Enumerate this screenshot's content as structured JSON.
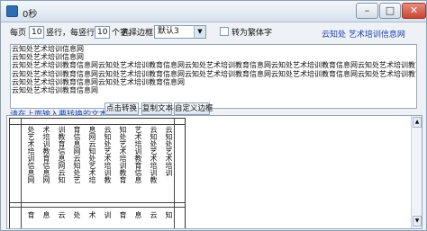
{
  "window": {
    "title": "0秒"
  },
  "options": {
    "per_page_label": "每页",
    "columns_value": "10",
    "columns_unit": "竖行，每竖行",
    "chars_value": "10",
    "chars_unit": "个字，",
    "border_label": "选择边框：",
    "border_selected": "默认3",
    "traditional_label": "转为繁体字"
  },
  "brand_link": "云知处 艺术培训信息网",
  "input_lines": [
    "云知处艺术培训信息网",
    "云知处艺术培训信息网",
    "云知处艺术培训教育信息网云知处艺术培训教育信息网云知处艺术培训教育信息网云知处艺术培训教育信息网云知处艺术培训教育信息网",
    "云知处艺术培训教育信息网云知处艺术培训教育信息网云知处艺术培训教育信息网云知处艺术培训教育信息网云知处艺术培训教育信息网",
    "云知处艺术培训教育信息网云知处艺术培训教育信息网",
    "云知处艺术培训教育信息网"
  ],
  "prompt": "请在上面输入要转换的文本！！",
  "buttons": {
    "convert": "点击转换",
    "copy": "复制文本",
    "border": "自定义边框"
  },
  "output_columns": [
    "处艺术培训信息网",
    "术培训教育信息网",
    "训教育信息网云知",
    "育信息网云知处艺",
    "息网云知处艺术培",
    "云知处艺术培训教",
    "知处艺术培训教育",
    "艺术培训教育信息",
    "云知处艺术培训教",
    "云知处艺术培训"
  ],
  "output_second_row": [
    "育",
    "息",
    "云",
    "处",
    "术",
    "训",
    "育",
    "息",
    "云",
    "知"
  ]
}
